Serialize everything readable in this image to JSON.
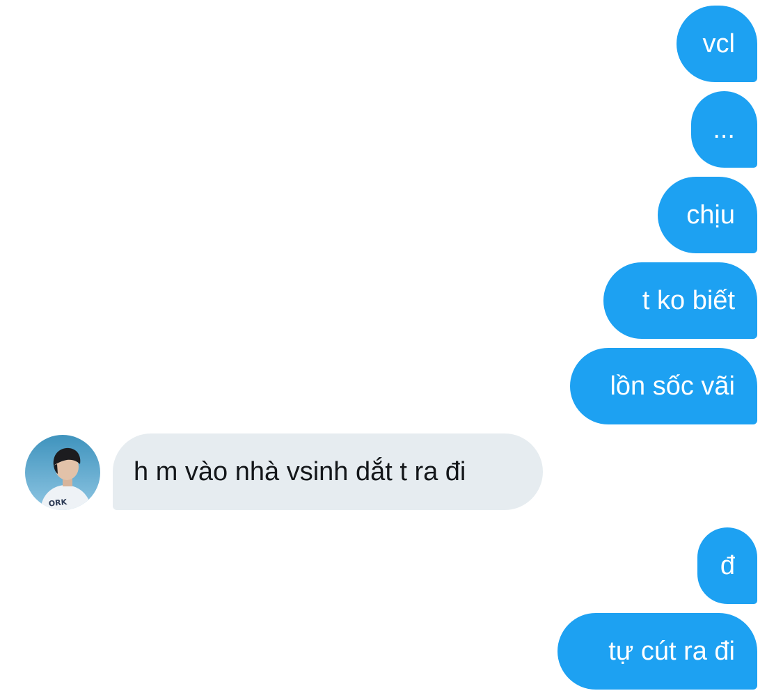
{
  "conversation": {
    "messages": [
      {
        "direction": "sent",
        "text": "vcl"
      },
      {
        "direction": "sent",
        "text": "..."
      },
      {
        "direction": "sent",
        "text": "chịu"
      },
      {
        "direction": "sent",
        "text": "t ko biết"
      },
      {
        "direction": "sent",
        "text": "lồn sốc vãi"
      },
      {
        "direction": "received",
        "text": "h m vào nhà vsinh dắt t ra đi"
      },
      {
        "direction": "sent",
        "text": "đ"
      },
      {
        "direction": "sent",
        "text": "tự cút ra đi"
      }
    ],
    "contact_avatar": {
      "icon": "profile-photo",
      "shirt_text": "ORK"
    }
  },
  "colors": {
    "sent_bubble": "#1da1f2",
    "sent_text": "#ffffff",
    "received_bubble": "#e6ecf0",
    "received_text": "#14171a",
    "background": "#ffffff"
  }
}
